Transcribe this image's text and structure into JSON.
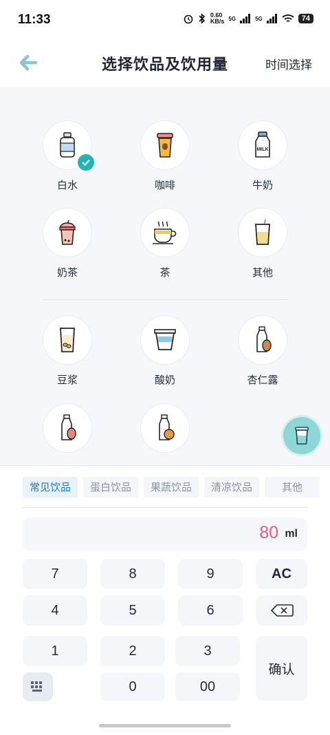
{
  "status": {
    "time": "11:33",
    "net_speed_value": "0.60",
    "net_speed_unit": "KB/s",
    "signal1": "5G",
    "signal2": "5G",
    "battery": "74"
  },
  "header": {
    "title": "选择饮品及饮用量",
    "right_action": "时间选择"
  },
  "drinks_top": [
    {
      "label": "白水",
      "icon": "water-bottle-icon",
      "selected": true
    },
    {
      "label": "咖啡",
      "icon": "coffee-cup-icon"
    },
    {
      "label": "牛奶",
      "icon": "milk-bottle-icon"
    },
    {
      "label": "奶茶",
      "icon": "milk-tea-icon"
    },
    {
      "label": "茶",
      "icon": "tea-cup-icon"
    },
    {
      "label": "其他",
      "icon": "other-drink-icon"
    }
  ],
  "drinks_more": [
    {
      "label": "豆浆",
      "icon": "soy-milk-icon"
    },
    {
      "label": "酸奶",
      "icon": "yogurt-icon"
    },
    {
      "label": "杏仁露",
      "icon": "almond-milk-icon"
    }
  ],
  "categories": [
    {
      "label": "常见饮品",
      "active": true
    },
    {
      "label": "蛋白饮品"
    },
    {
      "label": "果蔬饮品"
    },
    {
      "label": "清凉饮品"
    },
    {
      "label": "其他"
    }
  ],
  "amount": {
    "value": "80",
    "unit": "ml"
  },
  "keypad": {
    "k7": "7",
    "k8": "8",
    "k9": "9",
    "ac": "AC",
    "k4": "4",
    "k5": "5",
    "k6": "6",
    "k1": "1",
    "k2": "2",
    "k3": "3",
    "confirm": "确认",
    "k0": "0",
    "k00": "00"
  },
  "colors": {
    "accent": "#23b3b8",
    "amount": "#f0577e",
    "tab_active": "#1b7cc4"
  }
}
